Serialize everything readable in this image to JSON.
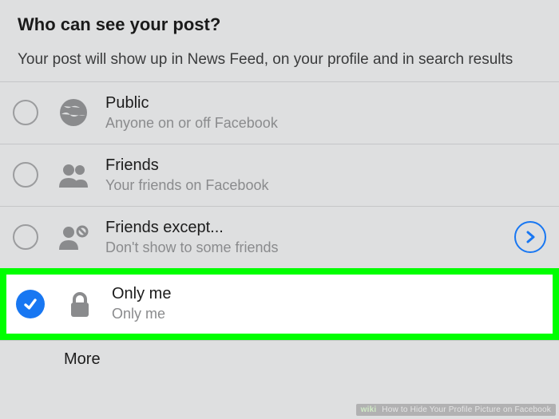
{
  "header": {
    "title": "Who can see your post?",
    "subtitle": "Your post will show up in News Feed, on your profile and in search results"
  },
  "options": [
    {
      "icon": "globe-icon",
      "title": "Public",
      "sub": "Anyone on or off Facebook",
      "selected": false,
      "disclosure": false
    },
    {
      "icon": "friends-icon",
      "title": "Friends",
      "sub": "Your friends on Facebook",
      "selected": false,
      "disclosure": false
    },
    {
      "icon": "friends-except-icon",
      "title": "Friends except...",
      "sub": "Don't show to some friends",
      "selected": false,
      "disclosure": true
    },
    {
      "icon": "lock-icon",
      "title": "Only me",
      "sub": "Only me",
      "selected": true,
      "disclosure": false,
      "highlighted": true
    }
  ],
  "more_label": "More",
  "watermark": {
    "brand": "wiki",
    "text": "How to Hide Your Profile Picture on Facebook"
  }
}
